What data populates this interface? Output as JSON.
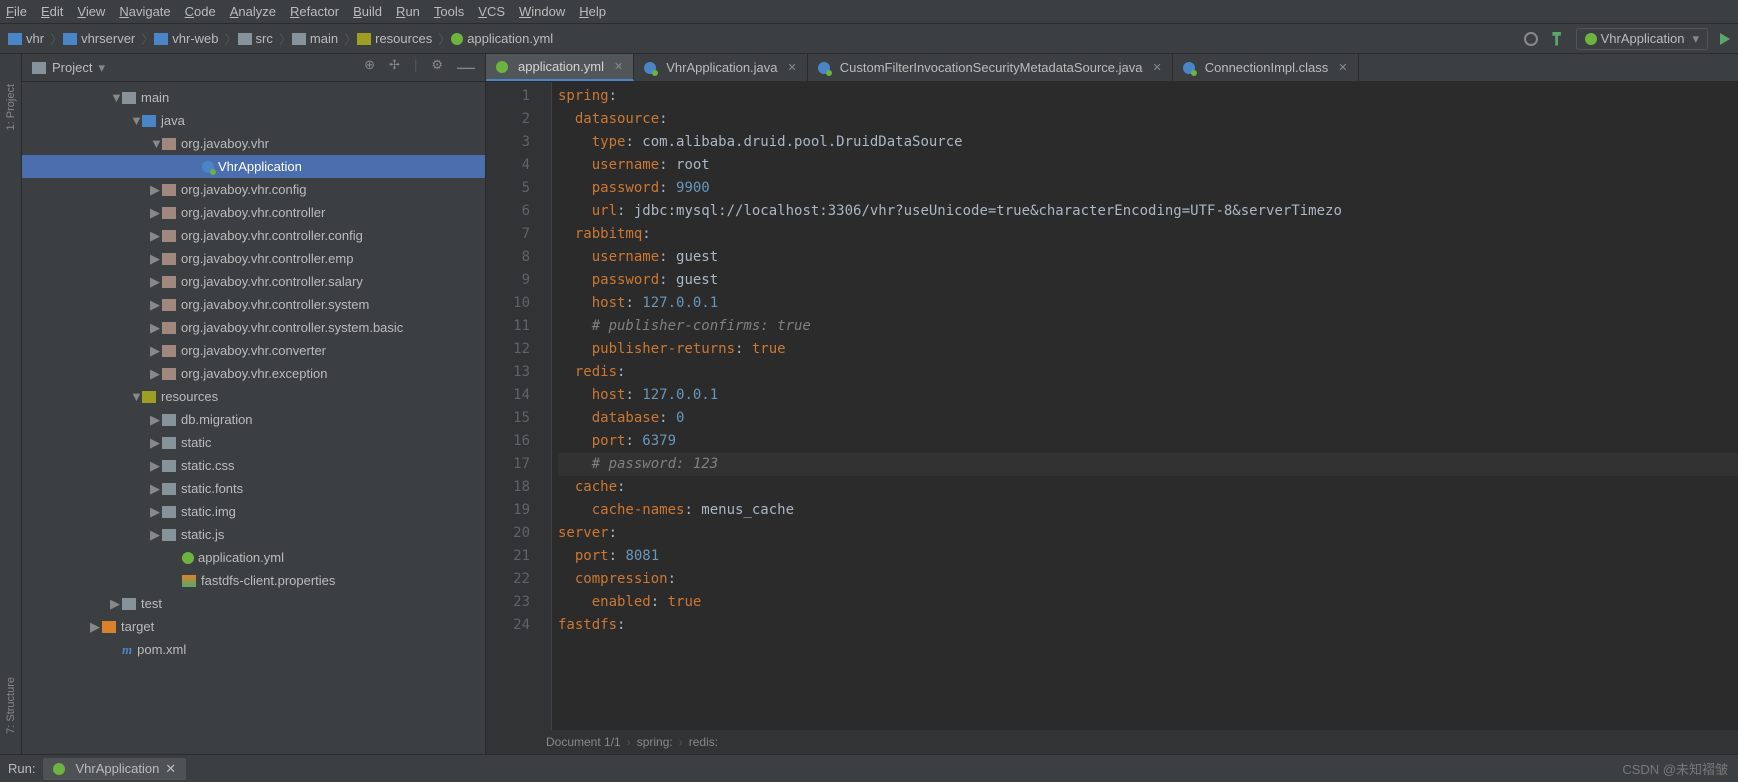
{
  "menu": [
    "File",
    "Edit",
    "View",
    "Navigate",
    "Code",
    "Analyze",
    "Refactor",
    "Build",
    "Run",
    "Tools",
    "VCS",
    "Window",
    "Help"
  ],
  "breadcrumbs": [
    {
      "icon": "folder-blue",
      "label": "vhr"
    },
    {
      "icon": "folder-blue",
      "label": "vhrserver"
    },
    {
      "icon": "folder-blue",
      "label": "vhr-web"
    },
    {
      "icon": "folder",
      "label": "src"
    },
    {
      "icon": "folder",
      "label": "main"
    },
    {
      "icon": "resfolder",
      "label": "resources"
    },
    {
      "icon": "spring",
      "label": "application.yml"
    }
  ],
  "runConfig": "VhrApplication",
  "projectTitle": "Project",
  "tree": [
    {
      "indent": 88,
      "tw": "▼",
      "icon": "folder",
      "label": "main"
    },
    {
      "indent": 108,
      "tw": "▼",
      "icon": "folder-blue",
      "label": "java"
    },
    {
      "indent": 128,
      "tw": "▼",
      "icon": "pkg",
      "label": "org.javaboy.vhr"
    },
    {
      "indent": 168,
      "tw": "",
      "icon": "java",
      "label": "VhrApplication",
      "selected": true
    },
    {
      "indent": 128,
      "tw": "▶",
      "icon": "pkg",
      "label": "org.javaboy.vhr.config"
    },
    {
      "indent": 128,
      "tw": "▶",
      "icon": "pkg",
      "label": "org.javaboy.vhr.controller"
    },
    {
      "indent": 128,
      "tw": "▶",
      "icon": "pkg",
      "label": "org.javaboy.vhr.controller.config"
    },
    {
      "indent": 128,
      "tw": "▶",
      "icon": "pkg",
      "label": "org.javaboy.vhr.controller.emp"
    },
    {
      "indent": 128,
      "tw": "▶",
      "icon": "pkg",
      "label": "org.javaboy.vhr.controller.salary"
    },
    {
      "indent": 128,
      "tw": "▶",
      "icon": "pkg",
      "label": "org.javaboy.vhr.controller.system"
    },
    {
      "indent": 128,
      "tw": "▶",
      "icon": "pkg",
      "label": "org.javaboy.vhr.controller.system.basic"
    },
    {
      "indent": 128,
      "tw": "▶",
      "icon": "pkg",
      "label": "org.javaboy.vhr.converter"
    },
    {
      "indent": 128,
      "tw": "▶",
      "icon": "pkg",
      "label": "org.javaboy.vhr.exception"
    },
    {
      "indent": 108,
      "tw": "▼",
      "icon": "resfolder",
      "label": "resources"
    },
    {
      "indent": 128,
      "tw": "▶",
      "icon": "folder",
      "label": "db.migration"
    },
    {
      "indent": 128,
      "tw": "▶",
      "icon": "folder",
      "label": "static"
    },
    {
      "indent": 128,
      "tw": "▶",
      "icon": "folder",
      "label": "static.css"
    },
    {
      "indent": 128,
      "tw": "▶",
      "icon": "folder",
      "label": "static.fonts"
    },
    {
      "indent": 128,
      "tw": "▶",
      "icon": "folder",
      "label": "static.img"
    },
    {
      "indent": 128,
      "tw": "▶",
      "icon": "folder",
      "label": "static.js"
    },
    {
      "indent": 148,
      "tw": "",
      "icon": "spring",
      "label": "application.yml"
    },
    {
      "indent": 148,
      "tw": "",
      "icon": "props",
      "label": "fastdfs-client.properties"
    },
    {
      "indent": 88,
      "tw": "▶",
      "icon": "folder",
      "label": "test"
    },
    {
      "indent": 68,
      "tw": "▶",
      "icon": "folder-orange",
      "label": "target"
    },
    {
      "indent": 88,
      "tw": "",
      "icon": "maven",
      "label": "pom.xml"
    }
  ],
  "tabs": [
    {
      "icon": "spring",
      "label": "application.yml",
      "active": true
    },
    {
      "icon": "java",
      "label": "VhrApplication.java"
    },
    {
      "icon": "java",
      "label": "CustomFilterInvocationSecurityMetadataSource.java"
    },
    {
      "icon": "java",
      "label": "ConnectionImpl.class"
    }
  ],
  "code": [
    {
      "n": 1,
      "html": "<span class='k'>spring</span>:"
    },
    {
      "n": 2,
      "html": "  <span class='k'>datasource</span>:"
    },
    {
      "n": 3,
      "html": "    <span class='k'>type</span>: com.alibaba.druid.pool.DruidDataSource"
    },
    {
      "n": 4,
      "html": "    <span class='k'>username</span>: root"
    },
    {
      "n": 5,
      "html": "    <span class='k'>password</span>: <span class='n'>9900</span>"
    },
    {
      "n": 6,
      "html": "    <span class='k'>url</span>: jdbc:mysql://localhost:3306/vhr?useUnicode=true&amp;characterEncoding=UTF-8&amp;serverTimezo"
    },
    {
      "n": 7,
      "html": "  <span class='k'>rabbitmq</span>:"
    },
    {
      "n": 8,
      "html": "    <span class='k'>username</span>: guest"
    },
    {
      "n": 9,
      "html": "    <span class='k'>password</span>: guest"
    },
    {
      "n": 10,
      "html": "    <span class='k'>host</span>: <span class='n'>127.0.0.1</span>"
    },
    {
      "n": 11,
      "html": "    <span class='c'># publisher-confirms: true</span>"
    },
    {
      "n": 12,
      "html": "    <span class='k'>publisher-returns</span>: <span class='k'>true</span>"
    },
    {
      "n": 13,
      "html": "  <span class='k'>redis</span>:"
    },
    {
      "n": 14,
      "html": "    <span class='k'>host</span>: <span class='n'>127.0.0.1</span>"
    },
    {
      "n": 15,
      "html": "    <span class='k'>database</span>: <span class='n'>0</span>"
    },
    {
      "n": 16,
      "html": "    <span class='k'>port</span>: <span class='n'>6379</span>"
    },
    {
      "n": 17,
      "html": "    <span class='c'># password: 123</span>",
      "hl": true
    },
    {
      "n": 18,
      "html": "  <span class='k'>cache</span>:"
    },
    {
      "n": 19,
      "html": "    <span class='k'>cache-names</span>: menus_cache"
    },
    {
      "n": 20,
      "html": "<span class='k'>server</span>:"
    },
    {
      "n": 21,
      "html": "  <span class='k'>port</span>: <span class='n'>8081</span>"
    },
    {
      "n": 22,
      "html": "  <span class='k'>compression</span>:"
    },
    {
      "n": 23,
      "html": "    <span class='k'>enabled</span>: <span class='k'>true</span>"
    },
    {
      "n": 24,
      "html": "<span class='k'>fastdfs</span>:"
    }
  ],
  "crumbBar": [
    "Document 1/1",
    "spring:",
    "redis:"
  ],
  "leftTabs": [
    "1: Project",
    "7: Structure"
  ],
  "bottom": {
    "run": "Run:",
    "tab": "VhrApplication"
  },
  "watermark": "CSDN @未知褶皱"
}
